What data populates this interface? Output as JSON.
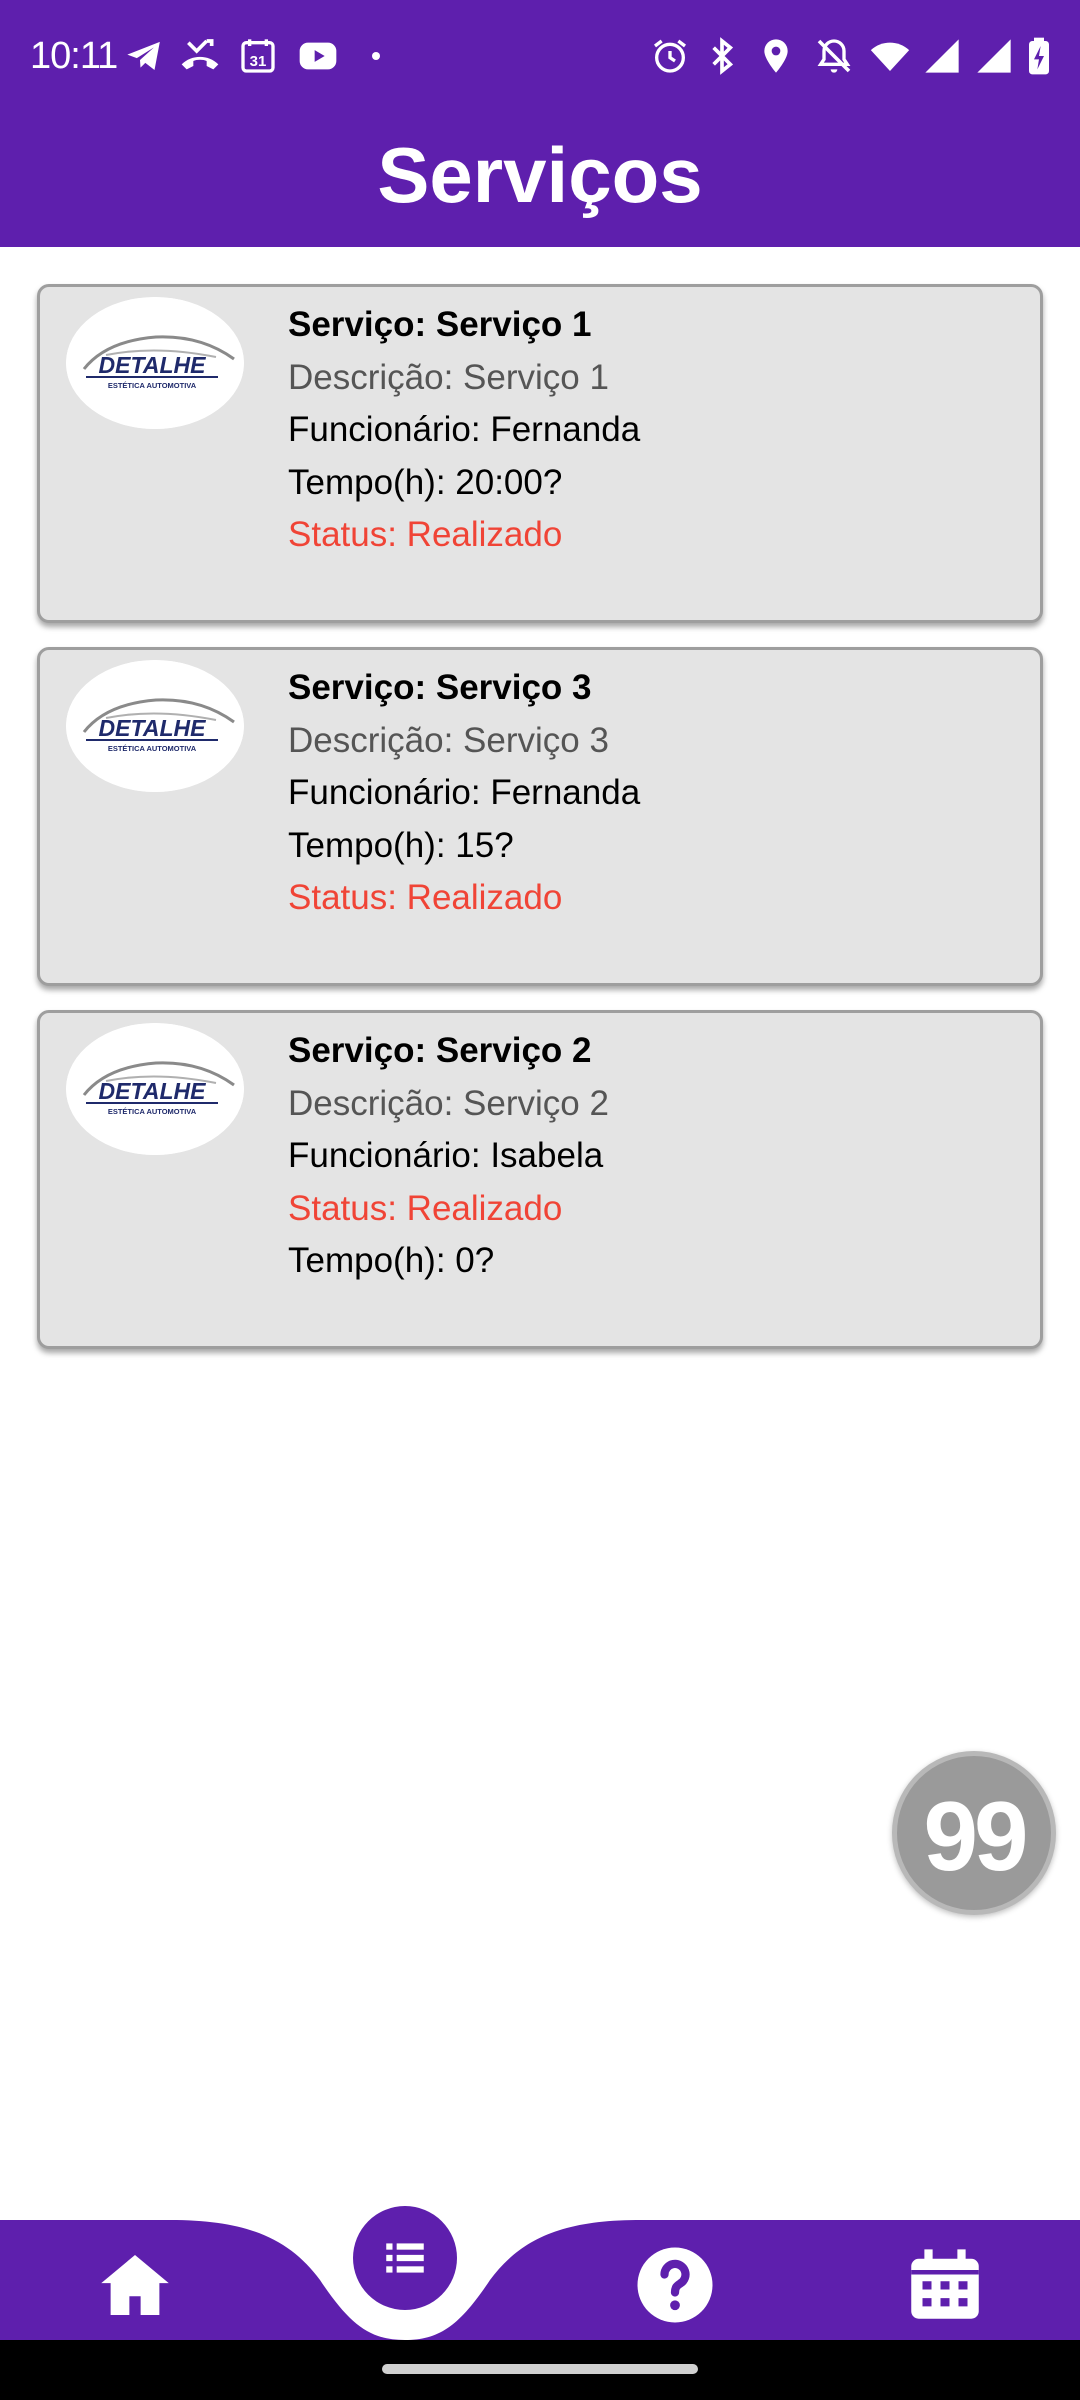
{
  "status_bar": {
    "time": "10:11",
    "left_icons": [
      "telegram-icon",
      "missed-call-icon",
      "calendar-31-icon",
      "youtube-icon",
      "dot-icon"
    ],
    "right_icons": [
      "alarm-icon",
      "bluetooth-icon",
      "location-icon",
      "notifications-off-icon",
      "wifi-icon",
      "signal-icon",
      "signal-icon",
      "battery-charging-icon"
    ],
    "calendar_day": "31"
  },
  "header": {
    "title": "Serviços"
  },
  "services": [
    {
      "title": "Serviço: Serviço 1",
      "description": "Descrição: Serviço 1",
      "employee": "Funcionário: Fernanda",
      "time": "Tempo(h): 20:00?",
      "status": "Status: Realizado"
    },
    {
      "title": "Serviço: Serviço 3",
      "description": "Descrição: Serviço 3",
      "employee": "Funcionário: Fernanda",
      "time": "Tempo(h): 15?",
      "status": "Status: Realizado"
    },
    {
      "title": "Serviço: Serviço 2",
      "description": "Descrição: Serviço 2",
      "employee": "Funcionário: Isabela",
      "status": "Status: Realizado",
      "time": "Tempo(h): 0?"
    }
  ],
  "logo": {
    "brand": "DETALHE",
    "tagline": "ESTÉTICA AUTOMOTIVA"
  },
  "floating_badge": {
    "label": "99"
  },
  "bottom_nav": {
    "items": [
      "home-icon",
      "list-icon",
      "help-icon",
      "calendar-icon"
    ],
    "active": "list-icon"
  },
  "colors": {
    "primary": "#5e1fad",
    "card_background": "#e4e4e4",
    "status_red": "#f04436",
    "badge_gray": "#9a9a9a"
  }
}
